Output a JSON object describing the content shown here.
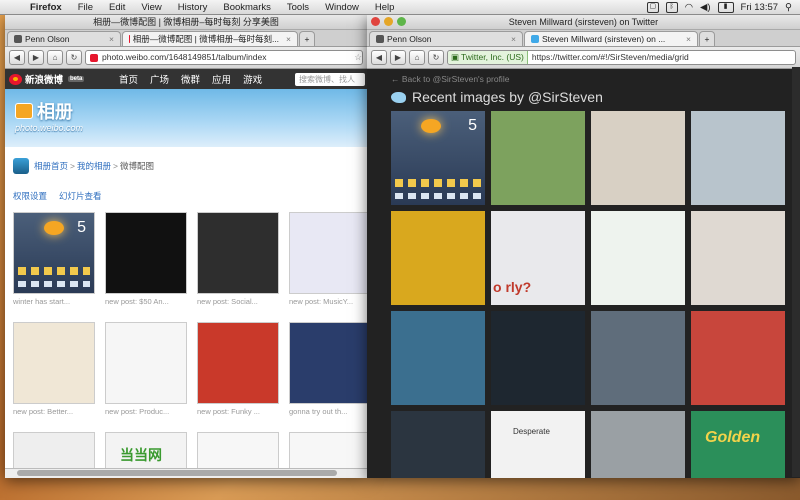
{
  "menubar": {
    "app": "Firefox",
    "items": [
      "File",
      "Edit",
      "View",
      "History",
      "Bookmarks",
      "Tools",
      "Window",
      "Help"
    ],
    "clock": "Fri 13:57"
  },
  "left_window": {
    "title": "相册—微博配图 | 微博相册–每时每刻 分享美图",
    "tabs": [
      {
        "label": "Penn Olson",
        "active": false
      },
      {
        "label": "相册—微博配图 | 微博相册–每时每刻...",
        "active": true
      }
    ],
    "url": "photo.weibo.com/1648149851/talbum/index",
    "weibo": {
      "logo": "新浪微博",
      "beta": "beta",
      "nav": [
        "首页",
        "广场",
        "微群",
        "应用",
        "游戏"
      ],
      "search_placeholder": "搜索微博、找人",
      "album_title": "相册",
      "album_domain": "photo.weibo.com",
      "breadcrumb": [
        "相册首页",
        "我的相册",
        "微博配图"
      ],
      "tools": [
        "权限设置",
        "幻灯片查看"
      ],
      "thumbs": [
        {
          "caption": "winter has start...",
          "color": "#3a4d68"
        },
        {
          "caption": "new post: $50 An...",
          "color": "#111111"
        },
        {
          "caption": "new post: Social...",
          "color": "#2e2e2e"
        },
        {
          "caption": "new post: MusicY...",
          "color": "#e8e8f4"
        },
        {
          "caption": "new post: Better...",
          "color": "#f0e7d6"
        },
        {
          "caption": "new post: Produc...",
          "color": "#f6f6f6"
        },
        {
          "caption": "new post: Funky ...",
          "color": "#c9392a"
        },
        {
          "caption": "gonna try out th...",
          "color": "#2a3d6b"
        },
        {
          "caption": "",
          "color": "#eeeeee"
        },
        {
          "caption": "",
          "color": "#f3f3f3"
        },
        {
          "caption": "",
          "color": "#f7f7f7"
        },
        {
          "caption": "",
          "color": "#f7f7f7"
        }
      ],
      "dangdang_label": "当当网"
    }
  },
  "right_window": {
    "title": "Steven Millward (sirsteven) on Twitter",
    "tabs": [
      {
        "label": "Penn Olson",
        "active": false
      },
      {
        "label": "Steven Millward (sirsteven) on ...",
        "active": true
      }
    ],
    "site_identity": "Twitter, Inc. (US)",
    "url": "https://twitter.com/#!/SirSteven/media/grid",
    "twitter": {
      "back_link": "← Back to @SirSteven's profile",
      "heading": "Recent images by @SirSteven",
      "tiles": [
        {
          "color": "#3c4f6b"
        },
        {
          "color": "#7da25e"
        },
        {
          "color": "#d8d0c4"
        },
        {
          "color": "#b8c4cc"
        },
        {
          "color": "#d9a81e"
        },
        {
          "color": "#e9e9ec"
        },
        {
          "color": "#eef3ee"
        },
        {
          "color": "#dfd9d2"
        },
        {
          "color": "#3b6f8f"
        },
        {
          "color": "#1e2730"
        },
        {
          "color": "#5f6d7b"
        },
        {
          "color": "#c8463c"
        },
        {
          "color": "#2b3540"
        },
        {
          "color": "#f2f2f2"
        },
        {
          "color": "#9aa0a4"
        },
        {
          "color": "#2b8f5a"
        }
      ],
      "tile_texts": {
        "orly": "o rly?",
        "google": "Desperate",
        "golden": "Golden"
      }
    }
  }
}
